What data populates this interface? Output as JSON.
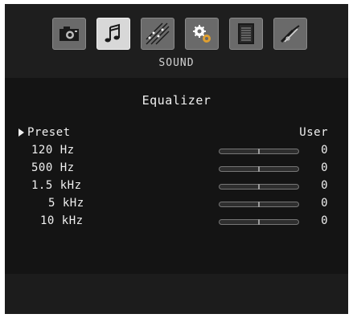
{
  "header": {
    "category_label": "SOUND",
    "icons": [
      "camera-icon",
      "music-note-icon",
      "broadcast-stars-icon",
      "gears-icon",
      "document-icon",
      "tools-icon"
    ],
    "selected_icon": "music-note-icon"
  },
  "equalizer": {
    "title": "Equalizer",
    "preset": {
      "label": "Preset",
      "value": "User"
    },
    "bands": [
      {
        "label": "120 Hz",
        "value": "0",
        "level": 0.5
      },
      {
        "label": "500 Hz",
        "value": "0",
        "level": 0.5
      },
      {
        "label": "1.5 kHz",
        "value": "0",
        "level": 0.5
      },
      {
        "label": "5 kHz",
        "value": "0",
        "level": 0.5
      },
      {
        "label": "10 kHz",
        "value": "0",
        "level": 0.5
      }
    ]
  },
  "colors": {
    "panel_background": "#141414",
    "text": "#f0f0f0",
    "selected_icon": "#d8d8d8",
    "icon": "#6a6a6a"
  }
}
